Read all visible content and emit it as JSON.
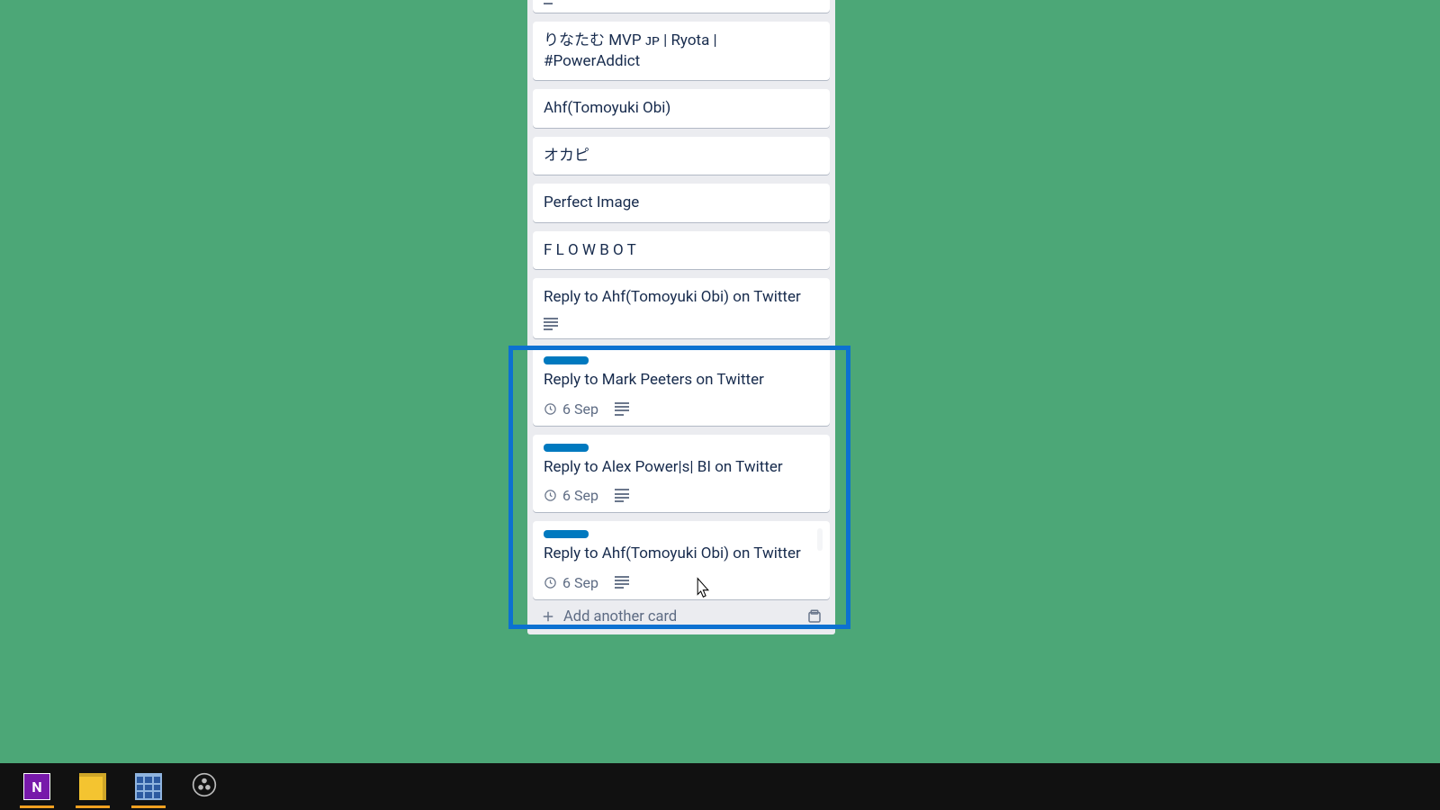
{
  "list": {
    "cards": [
      {
        "has_desc": true
      },
      {
        "title": "りなたむ MVP ᴊᴘ | Ryota | #PowerAddict"
      },
      {
        "title": "Ahf(Tomoyuki Obi)"
      },
      {
        "title": "オカピ"
      },
      {
        "title": "Perfect Image"
      },
      {
        "title": "F L O W B O T"
      },
      {
        "title": "Reply to Ahf(Tomoyuki Obi) on Twitter",
        "has_desc": true
      },
      {
        "title": "Reply to Mark Peeters on Twitter",
        "label": "blue",
        "due": "6 Sep",
        "has_desc": true
      },
      {
        "title": "Reply to Alex Power|s| BI on Twitter",
        "label": "blue",
        "due": "6 Sep",
        "has_desc": true
      },
      {
        "title": "Reply to Ahf(Tomoyuki Obi) on Twitter",
        "label": "blue",
        "due": "6 Sep",
        "has_desc": true,
        "hover": true
      }
    ],
    "add_card_label": "Add another card"
  },
  "taskbar": {
    "apps": [
      "onenote",
      "sticky-notes",
      "calculator",
      "obs"
    ]
  }
}
